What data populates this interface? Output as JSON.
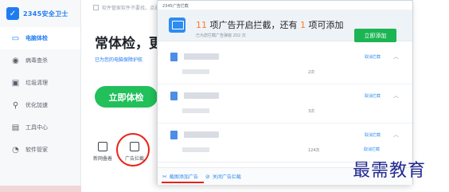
{
  "app": {
    "logo_text": "2345安全卫士",
    "sidebar": [
      {
        "label": "电脑体检",
        "icon": "monitor-icon",
        "active": true
      },
      {
        "label": "病毒查杀",
        "icon": "virus-scan-icon",
        "active": false
      },
      {
        "label": "垃圾清理",
        "icon": "trash-icon",
        "active": false
      },
      {
        "label": "优化加速",
        "icon": "rocket-icon",
        "active": false
      },
      {
        "label": "工具中心",
        "icon": "toolbox-icon",
        "active": false
      },
      {
        "label": "软件管家",
        "icon": "software-icon",
        "active": false
      }
    ],
    "top_note": "软件管家软件不要找，点击查…",
    "big_title": "常体检，更",
    "sub_note": "已为您的电脑保障护航",
    "check_button": "立即体检",
    "tools": [
      {
        "label": "新网叠着",
        "icon": "bell-box-icon"
      },
      {
        "label": "广告拦截",
        "icon": "ad-block-icon"
      }
    ]
  },
  "popup": {
    "window_title": "2345广告拦截",
    "headline_prefix": "",
    "headline_count_1": "11",
    "headline_mid": " 项广告开启拦截，还有 ",
    "headline_count_2": "1",
    "headline_suffix": " 项可添加",
    "sub_text": "已为您拦截广告弹窗 202 次",
    "add_button": "立即添加",
    "groups": [
      {
        "action": "取消拦截",
        "sub_count": "2次",
        "sub_action": "取消拦截"
      },
      {
        "action": "取消拦截",
        "sub_count": "3次",
        "sub_action": "取消拦截"
      },
      {
        "action": "取消拦截",
        "sub_count": "124次",
        "sub_action": "取消拦截"
      }
    ],
    "footer_left": "截图添加广告",
    "footer_right": "关闭广告拦截"
  },
  "watermark": "最需教育",
  "colors": {
    "accent_blue": "#1e7cf2",
    "brand_green": "#21c05a",
    "count_orange": "#ff7a22",
    "highlight_red": "#e8231a"
  }
}
